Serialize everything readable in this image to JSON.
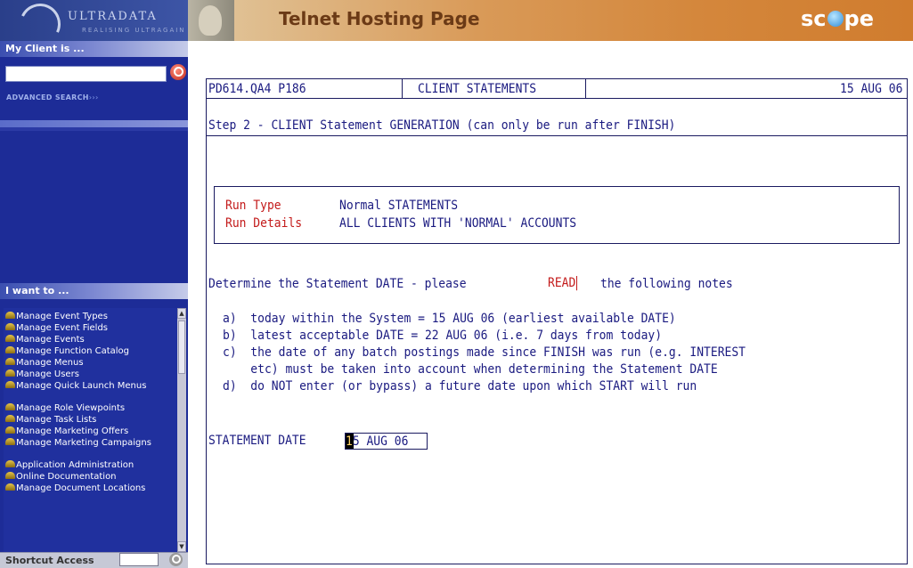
{
  "sidebar": {
    "logo_text": "ULTRADATA",
    "logo_tagline": "REALISING ULTRAGAIN",
    "client_header": "My Client is ...",
    "client_input_value": "",
    "advanced_search": "ADVANCED SEARCH",
    "advanced_search_arrows": "›››",
    "iwant_header": "I want to ...",
    "menu_items": [
      "Manage Event Types",
      "Manage Event Fields",
      "Manage Events",
      "Manage Function Catalog",
      "Manage Menus",
      "Manage Users",
      "Manage Quick Launch Menus",
      "Manage Role Viewpoints",
      "Manage Task Lists",
      "Manage Marketing Offers",
      "Manage Marketing Campaigns",
      "Application Administration",
      "Online Documentation",
      "Manage Document Locations"
    ],
    "shortcut_label": "Shortcut Access",
    "shortcut_value": ""
  },
  "banner": {
    "title": "Telnet Hosting Page",
    "logo_left": "sc",
    "logo_right": "pe"
  },
  "terminal": {
    "screen_id": "PD614.QA4 P186",
    "screen_title": "CLIENT STATEMENTS",
    "date": "15 AUG 06",
    "step": "Step 2 - CLIENT Statement GENERATION (can only be run after FINISH)",
    "run_type_label": "Run Type",
    "run_type_value": "Normal STATEMENTS",
    "run_details_label": "Run Details",
    "run_details_value": "ALL CLIENTS WITH 'NORMAL' ACCOUNTS",
    "determine_prefix": "Determine the Statement DATE - please",
    "read_link": "READ",
    "determine_suffix": "the following notes",
    "notes": [
      "a)  today within the System = 15 AUG 06 (earliest available DATE)",
      "b)  latest acceptable DATE = 22 AUG 06 (i.e. 7 days from today)",
      "c)  the date of any batch postings made since FINISH was run (e.g. INTEREST",
      "    etc) must be taken into account when determining the Statement DATE",
      "d)  do NOT enter (or bypass) a future date upon which START will run"
    ],
    "statement_date_label": "STATEMENT DATE",
    "statement_date_first": "1",
    "statement_date_rest": "5 AUG 06"
  }
}
